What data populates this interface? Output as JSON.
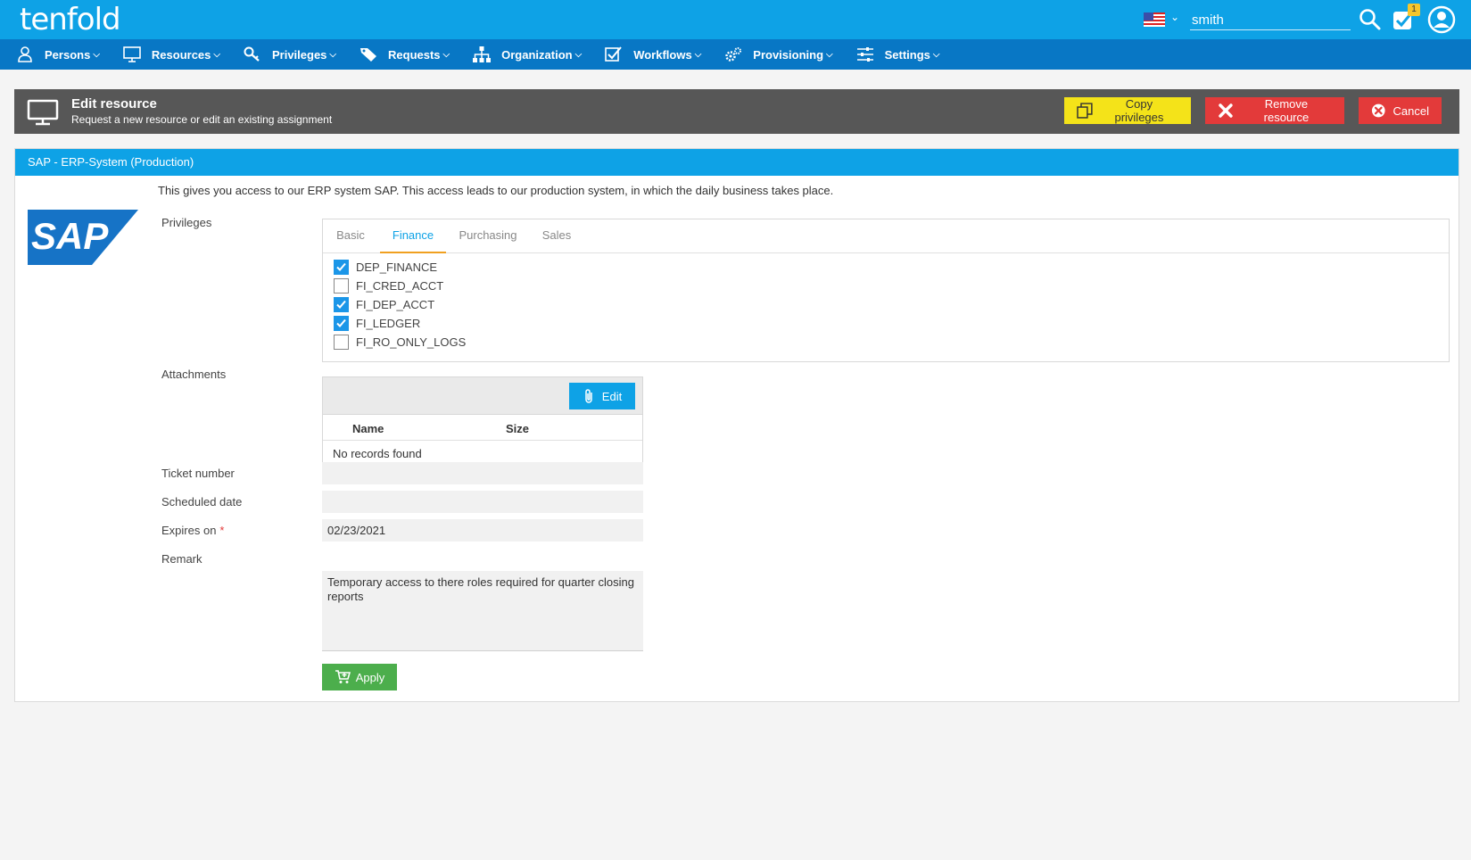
{
  "app": {
    "logo": "tenfold"
  },
  "topbar": {
    "user_value": "smith",
    "tasks_badge": "1",
    "flag_icon": "us-flag-icon"
  },
  "nav": {
    "items": [
      {
        "label": "Persons",
        "icon": "person-icon"
      },
      {
        "label": "Resources",
        "icon": "monitor-icon"
      },
      {
        "label": "Privileges",
        "icon": "key-icon"
      },
      {
        "label": "Requests",
        "icon": "tag-icon"
      },
      {
        "label": "Organization",
        "icon": "org-chart-icon"
      },
      {
        "label": "Workflows",
        "icon": "check-square-icon"
      },
      {
        "label": "Provisioning",
        "icon": "gears-icon"
      },
      {
        "label": "Settings",
        "icon": "sliders-icon"
      }
    ]
  },
  "header": {
    "title": "Edit resource",
    "subtitle": "Request a new resource or edit an existing assignment",
    "copy_label": "Copy privileges",
    "remove_label": "Remove resource",
    "cancel_label": "Cancel"
  },
  "resource": {
    "title": "SAP - ERP-System (Production)",
    "description": "This gives you access to our ERP system SAP. This access leads to our production system, in which the daily business takes place.",
    "logo_text": "SAP"
  },
  "form": {
    "privileges_label": "Privileges",
    "tabs": [
      {
        "label": "Basic",
        "active": false
      },
      {
        "label": "Finance",
        "active": true
      },
      {
        "label": "Purchasing",
        "active": false
      },
      {
        "label": "Sales",
        "active": false
      }
    ],
    "privileges": [
      {
        "name": "DEP_FINANCE",
        "checked": true
      },
      {
        "name": "FI_CRED_ACCT",
        "checked": false
      },
      {
        "name": "FI_DEP_ACCT",
        "checked": true
      },
      {
        "name": "FI_LEDGER",
        "checked": true
      },
      {
        "name": "FI_RO_ONLY_LOGS",
        "checked": false
      }
    ],
    "attachments_label": "Attachments",
    "attachments": {
      "edit_label": "Edit",
      "col_name": "Name",
      "col_size": "Size",
      "empty_text": "No records found"
    },
    "ticket_label": "Ticket number",
    "ticket_value": "",
    "scheduled_label": "Scheduled date",
    "scheduled_value": "",
    "expires_label": "Expires on",
    "expires_required": "*",
    "expires_value": "02/23/2021",
    "remark_label": "Remark",
    "remark_value": "Temporary access to there roles required for quarter closing reports",
    "apply_label": "Apply"
  },
  "colors": {
    "topbar": "#0ea2e6",
    "navbar": "#0877c5",
    "copy_button": "#f4e319",
    "danger_button": "#e33a3a",
    "apply_button": "#4cae4c",
    "active_tab_underline": "#f0a020"
  }
}
